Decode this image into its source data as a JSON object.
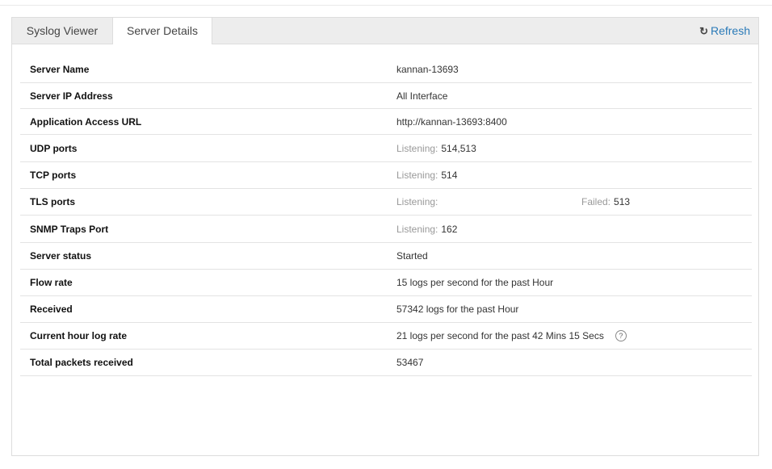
{
  "tabs": [
    {
      "label": "Syslog Viewer"
    },
    {
      "label": "Server Details"
    }
  ],
  "refresh_label": "Refresh",
  "refresh_icon": "refresh-icon",
  "help_icon": "?",
  "rows": [
    {
      "label": "Server Name",
      "value": "kannan-13693"
    },
    {
      "label": "Server IP Address",
      "value": "All Interface"
    },
    {
      "label": "Application Access URL",
      "value": "http://kannan-13693:8400"
    },
    {
      "label": "UDP ports",
      "prefix": "Listening:",
      "value": "514,513"
    },
    {
      "label": "TCP ports",
      "prefix": "Listening:",
      "value": "514"
    },
    {
      "label": "TLS ports",
      "prefix": "Listening:",
      "value": "",
      "failed_prefix": "Failed:",
      "failed_value": "513"
    },
    {
      "label": "SNMP Traps Port",
      "prefix": "Listening:",
      "value": "162"
    },
    {
      "label": "Server status",
      "value": "Started"
    },
    {
      "label": "Flow rate",
      "value": "15 logs per second for the past Hour"
    },
    {
      "label": "Received",
      "value": "57342 logs for the past Hour"
    },
    {
      "label": "Current hour log rate",
      "value": "21 logs per second for the past 42 Mins 15 Secs"
    },
    {
      "label": "Total packets received",
      "value": "53467"
    }
  ]
}
